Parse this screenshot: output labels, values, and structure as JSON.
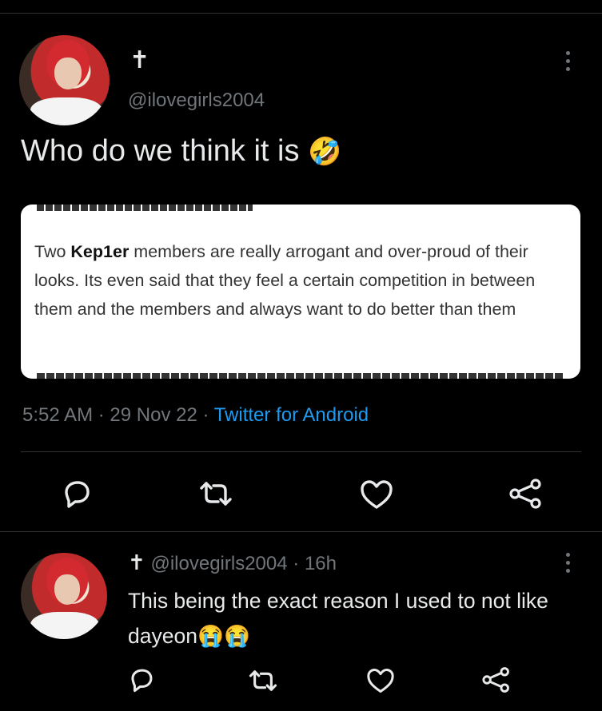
{
  "tweet": {
    "display_name": "✝",
    "handle": "@ilovegirls2004",
    "text": "Who do we think it is",
    "emoji": "🤣",
    "quote": {
      "text_before": "Two ",
      "text_bold": "Kep1er",
      "text_after": " members are really arrogant and over-proud of their looks. Its even said that they feel a certain competition in between them and the members and always want to do better than them"
    },
    "time": "5:52 AM",
    "date": "29 Nov 22",
    "source": "Twitter for Android"
  },
  "reply": {
    "display_name": "✝",
    "handle": "@ilovegirls2004",
    "age": "16h",
    "text": "This being the exact reason I used to not like dayeon",
    "emoji": "😭😭"
  },
  "icons": [
    "reply-icon",
    "retweet-icon",
    "like-icon",
    "share-icon",
    "more-options-icon"
  ]
}
